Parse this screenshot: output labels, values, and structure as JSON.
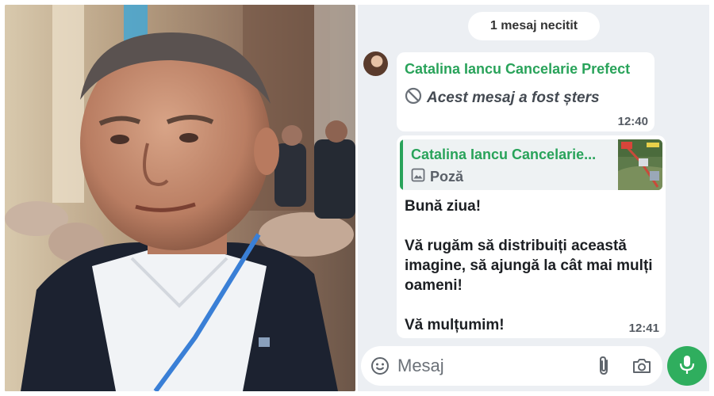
{
  "photo": {
    "alt_icon": "portrait-photo"
  },
  "chat": {
    "unread_banner": "1 mesaj necitit",
    "messages": [
      {
        "sender": "Catalina Iancu Cancelarie Prefect",
        "deleted_text": "Acest mesaj a fost șters",
        "time": "12:40"
      },
      {
        "reply_to": {
          "sender": "Catalina Iancu Cancelarie...",
          "type_label": "Poză"
        },
        "lines": [
          "Bună ziua!",
          "Vă rugăm să distribuiți această imagine, să ajungă la cât mai mulți oameni!",
          "Vă mulțumim!"
        ],
        "time": "12:41"
      }
    ],
    "input": {
      "placeholder": "Mesaj",
      "value": ""
    }
  },
  "colors": {
    "accent_green": "#29a35a",
    "mic_button": "#2fae5e",
    "chat_background": "#eceff3"
  },
  "icons": [
    "deleted-icon",
    "image-icon",
    "emoji-icon",
    "attach-icon",
    "camera-icon",
    "mic-icon"
  ]
}
